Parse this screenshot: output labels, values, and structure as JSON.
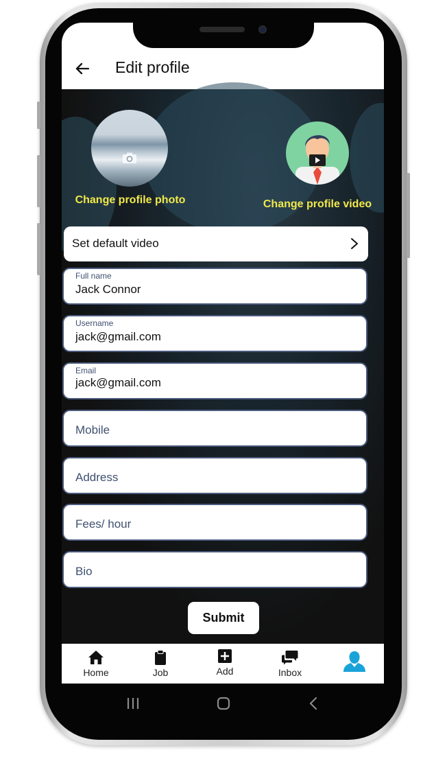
{
  "header": {
    "title": "Edit profile"
  },
  "profile": {
    "change_photo_label": "Change profile photo",
    "change_video_label": "Change profile video"
  },
  "default_video": {
    "label": "Set default video"
  },
  "fields": [
    {
      "label": "Full name",
      "value": "Jack Connor",
      "placeholder": ""
    },
    {
      "label": "Username",
      "value": "jack@gmail.com",
      "placeholder": ""
    },
    {
      "label": "Email",
      "value": "jack@gmail.com",
      "placeholder": ""
    },
    {
      "label": "",
      "value": "",
      "placeholder": "Mobile"
    },
    {
      "label": "",
      "value": "",
      "placeholder": "Address"
    },
    {
      "label": "",
      "value": "",
      "placeholder": "Fees/ hour"
    },
    {
      "label": "",
      "value": "",
      "placeholder": "Bio"
    }
  ],
  "submit_label": "Submit",
  "bottom_nav": {
    "active": "profile",
    "items": [
      {
        "label": "Home",
        "icon": "home-icon"
      },
      {
        "label": "Job",
        "icon": "clipboard-icon"
      },
      {
        "label": "Add",
        "icon": "add-icon"
      },
      {
        "label": "Inbox",
        "icon": "chat-icon"
      },
      {
        "label": "",
        "icon": "profile-icon"
      }
    ]
  },
  "colors": {
    "accent_yellow": "#f1e84a",
    "field_border": "#4b5a7e",
    "active_icon": "#1aa3d9"
  }
}
